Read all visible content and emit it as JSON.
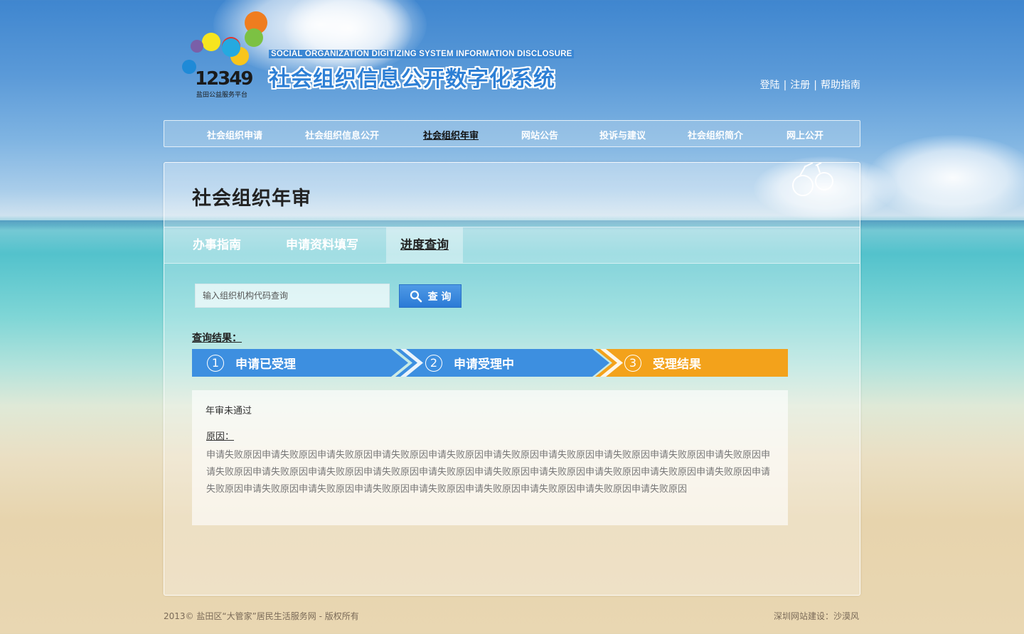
{
  "logo": {
    "number": "12349",
    "subtitle": "盐田公益服务平台"
  },
  "site": {
    "title_en": "SOCIAL ORGANIZATION DIGITIZING SYSTEM INFORMATION DISCLOSURE",
    "title_cn": "社会组织信息公开数字化系统"
  },
  "top_links": {
    "login": "登陆",
    "register": "注册",
    "help": "帮助指南",
    "separator": "|"
  },
  "nav": {
    "items": [
      {
        "label": "社会组织申请"
      },
      {
        "label": "社会组织信息公开"
      },
      {
        "label": "社会组织年审",
        "active": true
      },
      {
        "label": "网站公告"
      },
      {
        "label": "投诉与建议"
      },
      {
        "label": "社会组织简介"
      },
      {
        "label": "网上公开"
      }
    ]
  },
  "panel": {
    "title": "社会组织年审",
    "tabs": [
      {
        "label": "办事指南"
      },
      {
        "label": "申请资料填写"
      },
      {
        "label": "进度查询",
        "active": true
      }
    ]
  },
  "search": {
    "placeholder": "输入组织机构代码查询",
    "value": "",
    "button_label": "查 询"
  },
  "result": {
    "label": "查询结果：",
    "steps": [
      {
        "num": "1",
        "label": "申请已受理",
        "color": "#3d8fe0"
      },
      {
        "num": "2",
        "label": "申请受理中",
        "color": "#3d8fe0"
      },
      {
        "num": "3",
        "label": "受理结果",
        "color": "#f3a21b"
      }
    ],
    "status": "年审未通过",
    "reason_label": "原因：",
    "reason_text": "申请失败原因申请失败原因申请失败原因申请失败原因申请失败原因申请失败原因申请失败原因申请失败原因申请失败原因申请失败原因申请失败原因申请失败原因申请失败原因申请失败原因申请失败原因申请失败原因申请失败原因申请失败原因申请失败原因申请失败原因申请失败原因申请失败原因申请失败原因申请失败原因申请失败原因申请失败原因申请失败原因申请失败原因申请失败原因"
  },
  "footer": {
    "left": "2013© 盐田区“大管家”居民生活服务网 - 版权所有",
    "right": "深圳网站建设：沙漠风"
  },
  "icons": {
    "search": "search-icon",
    "bulbs": "light-bulb-icon"
  },
  "colors": {
    "brand_blue": "#3d8fe0",
    "accent_orange": "#f3a21b"
  }
}
